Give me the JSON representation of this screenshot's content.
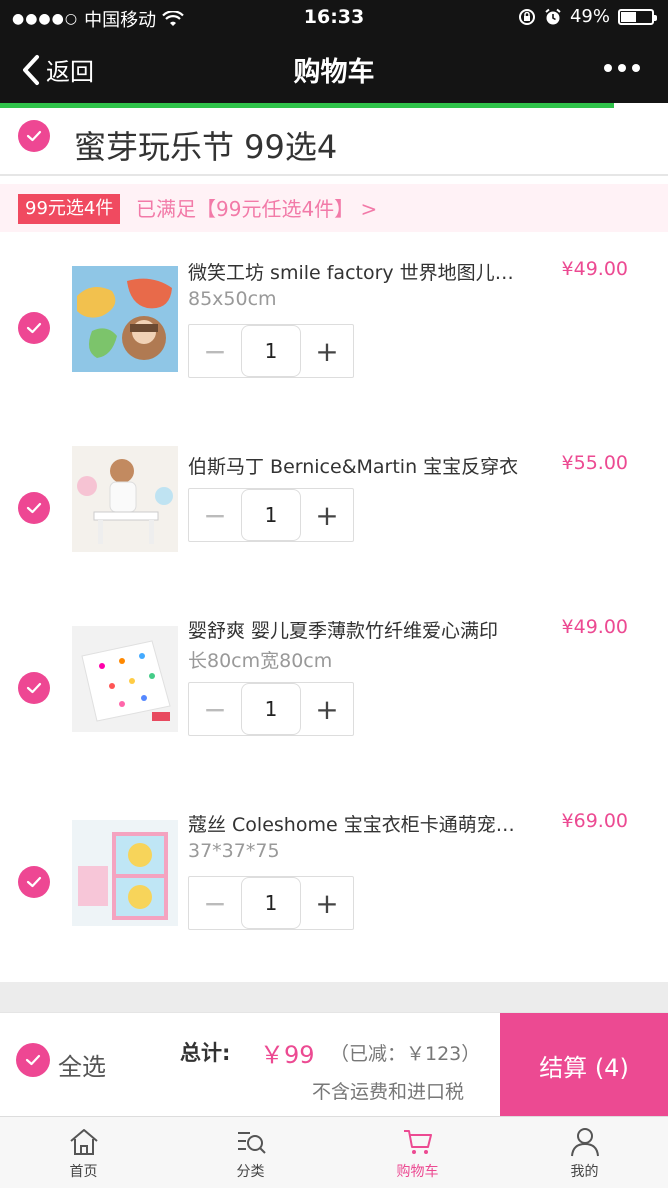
{
  "status": {
    "carrier": "中国移动",
    "time": "16:33",
    "battery": "49%",
    "battery_level": 0.49
  },
  "nav": {
    "back_label": "返回",
    "title": "购物车"
  },
  "store": {
    "name": "蜜芽玩乐节 99选4",
    "checked": true
  },
  "promo": {
    "tag": "99元选4件",
    "desc": "已满足【99元任选4件】 >"
  },
  "items": [
    {
      "name": "微笑工坊 smile factory 世界地图儿童拼图",
      "spec": "85x50cm",
      "price": "¥49.00",
      "qty": "1",
      "checked": true
    },
    {
      "name": "伯斯马丁 Bernice&Martin 宝宝反穿衣",
      "spec": "",
      "price": "¥55.00",
      "qty": "1",
      "checked": true
    },
    {
      "name": "婴舒爽 婴儿夏季薄款竹纤维爱心满印",
      "spec": "长80cm宽80cm",
      "price": "¥49.00",
      "qty": "1",
      "checked": true
    },
    {
      "name": "蔻丝 Coleshome 宝宝衣柜卡通萌宠收纳",
      "spec": "37*37*75",
      "price": "¥69.00",
      "qty": "1",
      "checked": true
    }
  ],
  "checkout": {
    "select_all": "全选",
    "total_label": "总计:",
    "total_value": "￥99",
    "saved": "（已减：￥123）",
    "note": "不含运费和进口税",
    "pay_button": "结算 (4)"
  },
  "tabs": [
    {
      "label": "首页",
      "icon": "home-icon",
      "active": false
    },
    {
      "label": "分类",
      "icon": "category-search-icon",
      "active": false
    },
    {
      "label": "购物车",
      "icon": "cart-icon",
      "active": true
    },
    {
      "label": "我的",
      "icon": "user-icon",
      "active": false
    }
  ],
  "colors": {
    "accent": "#ec4a92",
    "promo_tag": "#f04a60",
    "progress": "#2fc34a"
  }
}
